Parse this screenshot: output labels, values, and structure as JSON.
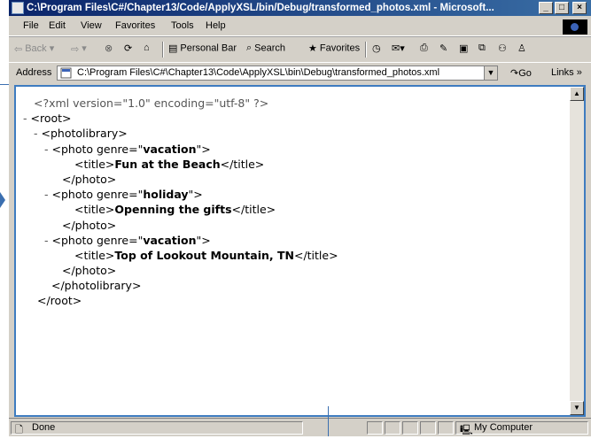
{
  "window": {
    "title": "C:\\Program Files\\C#/Chapter13/Code/ApplyXSL/bin/Debug/transformed_photos.xml - Microsoft...",
    "controls": {
      "minimize": "_",
      "maximize": "□",
      "close": "×"
    }
  },
  "menu": [
    "File",
    "Edit",
    "View",
    "Favorites",
    "Tools",
    "Help"
  ],
  "toolbar": {
    "back": "Back",
    "personal_bar": "Personal Bar",
    "search": "Search",
    "favorites": "Favorites"
  },
  "address": {
    "label": "Address",
    "url": "C:\\Program Files\\C#\\Chapter13\\Code\\ApplyXSL\\bin\\Debug\\transformed_photos.xml",
    "go": "Go",
    "links": "Links »"
  },
  "xml": {
    "decl": "<?xml version=\"1.0\" encoding=\"utf-8\" ?>",
    "root_open": "<root>",
    "photolibrary_open": "<photolibrary>",
    "photo1": {
      "open_pre": "<photo genre=\"",
      "genre": "vacation",
      "open_post": "\">",
      "title_open": "<title>",
      "title": "Fun at the Beach",
      "title_close": "</title>",
      "close": "</photo>"
    },
    "photo2": {
      "open_pre": "<photo genre=\"",
      "genre": "holiday",
      "open_post": "\">",
      "title_open": "<title>",
      "title": "Openning the gifts",
      "title_close": "</title>",
      "close": "</photo>"
    },
    "photo3": {
      "open_pre": "<photo genre=\"",
      "genre": "vacation",
      "open_post": "\">",
      "title_open": "<title>",
      "title": "Top of Lookout Mountain, TN",
      "title_close": "</title>",
      "close": "</photo>"
    },
    "photolibrary_close": "</photolibrary>",
    "root_close": "</root>",
    "collapse_marker": "-"
  },
  "status": {
    "text": "Done",
    "zone": "My Computer"
  }
}
